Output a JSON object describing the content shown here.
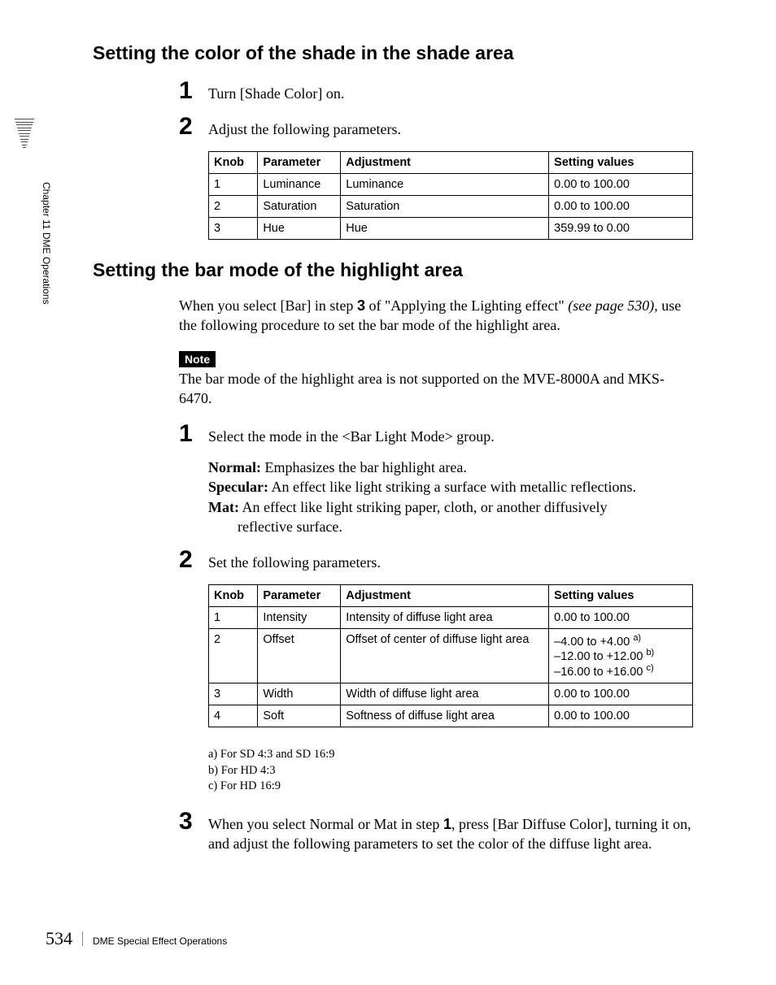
{
  "chapter_label": "Chapter 11  DME Operations",
  "section1": {
    "heading": "Setting the color of the shade in the shade area",
    "step1_num": "1",
    "step1_text": "Turn [Shade Color] on.",
    "step2_num": "2",
    "step2_text": "Adjust the following parameters.",
    "table": {
      "headers": {
        "knob": "Knob",
        "param": "Parameter",
        "adjust": "Adjustment",
        "setting": "Setting values"
      },
      "rows": [
        {
          "knob": "1",
          "param": "Luminance",
          "adjust": "Luminance",
          "setting": "0.00 to 100.00"
        },
        {
          "knob": "2",
          "param": "Saturation",
          "adjust": "Saturation",
          "setting": "0.00 to 100.00"
        },
        {
          "knob": "3",
          "param": "Hue",
          "adjust": "Hue",
          "setting": "359.99 to 0.00"
        }
      ]
    }
  },
  "section2": {
    "heading": "Setting the bar mode of the highlight area",
    "intro_pre": "When you select [Bar] in step ",
    "intro_bold": "3",
    "intro_mid": " of \"Applying the Lighting effect\" ",
    "intro_ital": "(see page 530)",
    "intro_post": ", use the following procedure to set the bar mode of the highlight area.",
    "note_label": "Note",
    "note_text": "The bar mode of the highlight area is not supported on the MVE-8000A and MKS-6470.",
    "step1_num": "1",
    "step1_text": "Select the mode in the <Bar Light Mode> group.",
    "modes": {
      "normal_name": "Normal:",
      "normal_desc": " Emphasizes the bar highlight area.",
      "specular_name": "Specular:",
      "specular_desc": " An effect like light striking a surface with metallic reflections.",
      "mat_name": "Mat:",
      "mat_desc": " An effect like light striking paper, cloth, or another diffusively",
      "mat_cont": "reflective surface."
    },
    "step2_num": "2",
    "step2_text": "Set the following parameters.",
    "table": {
      "headers": {
        "knob": "Knob",
        "param": "Parameter",
        "adjust": "Adjustment",
        "setting": "Setting values"
      },
      "rows": [
        {
          "knob": "1",
          "param": "Intensity",
          "adjust": "Intensity of diffuse light area",
          "setting": "0.00 to 100.00"
        },
        {
          "knob": "2",
          "param": "Offset",
          "adjust": "Offset of center of diffuse light area",
          "setting_l1": "–4.00 to +4.00 ",
          "sup1": "a)",
          "setting_l2": "–12.00 to +12.00 ",
          "sup2": "b)",
          "setting_l3": "–16.00 to +16.00 ",
          "sup3": "c)"
        },
        {
          "knob": "3",
          "param": "Width",
          "adjust": "Width of diffuse light area",
          "setting": "0.00 to 100.00"
        },
        {
          "knob": "4",
          "param": "Soft",
          "adjust": "Softness of diffuse light area",
          "setting": "0.00 to 100.00"
        }
      ]
    },
    "footnotes": {
      "a": "a) For SD 4:3 and SD 16:9",
      "b": "b) For HD 4:3",
      "c": "c) For HD 16:9"
    },
    "step3_num": "3",
    "step3_pre": "When you select Normal or Mat in step ",
    "step3_bold": "1",
    "step3_post": ", press [Bar Diffuse Color], turning it on, and adjust the following parameters to set the color of the diffuse light area."
  },
  "footer": {
    "page": "534",
    "text": "DME Special Effect Operations"
  }
}
